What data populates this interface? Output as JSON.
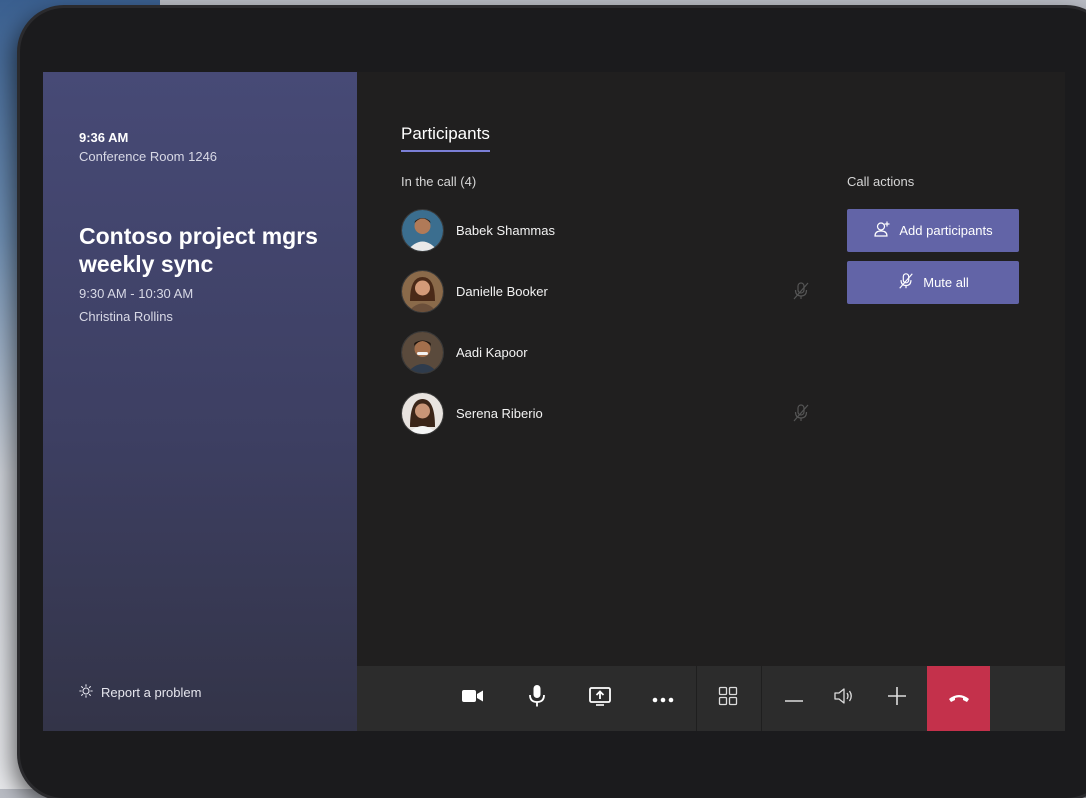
{
  "status": {
    "time": "9:36 AM",
    "room": "Conference Room 1246"
  },
  "meeting": {
    "title": "Contoso project mgrs weekly sync",
    "time_range": "9:30 AM - 10:30 AM",
    "organizer": "Christina Rollins"
  },
  "report_label": "Report a problem",
  "participants_panel": {
    "tab_label": "Participants",
    "in_call_label": "In the call (4)",
    "people": [
      {
        "name": "Babek Shammas",
        "muted": false
      },
      {
        "name": "Danielle Booker",
        "muted": true
      },
      {
        "name": "Aadi Kapoor",
        "muted": false
      },
      {
        "name": "Serena Riberio",
        "muted": true
      }
    ]
  },
  "call_actions": {
    "label": "Call actions",
    "add_participants": "Add participants",
    "mute_all": "Mute all"
  },
  "toolbar": {
    "icons": [
      "video-camera-icon",
      "microphone-icon",
      "share-screen-icon",
      "more-options-icon",
      "layout-grid-icon",
      "volume-down-icon",
      "speaker-icon",
      "volume-up-icon",
      "hang-up-icon"
    ]
  },
  "colors": {
    "accent": "#6264a7",
    "hangup": "#c4314b",
    "panel": "#474a76"
  }
}
